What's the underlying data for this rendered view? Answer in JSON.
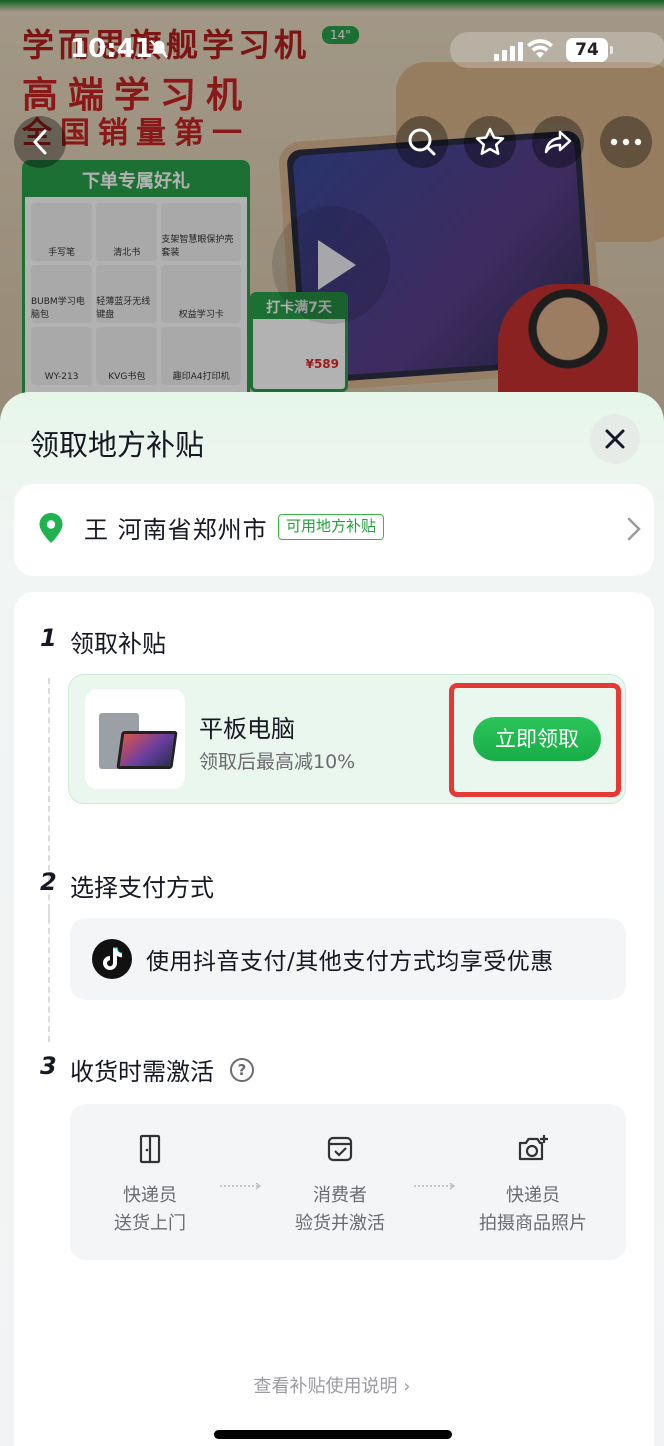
{
  "status_bar": {
    "time": "10:41",
    "battery": "74"
  },
  "background": {
    "headline_1": "学而思旗舰学习机",
    "badge": "14\"",
    "headline_2": "高端学习机",
    "headline_3": "全国销量第一",
    "gift_title": "下单专属好礼",
    "gift_items": [
      "手写笔",
      "清北书",
      "支架智慧眼保护壳套装",
      "BUBM学习电脑包",
      "轻薄蓝牙无线键盘",
      "权益学习卡",
      "WY-213",
      "KVG书包",
      "趣印A4打印机"
    ],
    "checkin_title": "打卡满7天",
    "checkin_price": "¥589"
  },
  "sheet": {
    "title": "领取地方补贴",
    "address": {
      "text": "王 河南省郑州市",
      "tag": "可用地方补贴"
    },
    "steps": [
      {
        "num": "1",
        "title": "领取补贴"
      },
      {
        "num": "2",
        "title": "选择支付方式"
      },
      {
        "num": "3",
        "title": "收货时需激活"
      }
    ],
    "product": {
      "name": "平板电脑",
      "desc": "领取后最高减10%",
      "button": "立即领取"
    },
    "payment": {
      "text": "使用抖音支付/其他支付方式均享受优惠"
    },
    "help": "?",
    "flow": [
      {
        "line1": "快递员",
        "line2": "送货上门",
        "icon": "door-icon"
      },
      {
        "line1": "消费者",
        "line2": "验货并激活",
        "icon": "box-check-icon"
      },
      {
        "line1": "快递员",
        "line2": "拍摄商品照片",
        "icon": "camera-add-icon"
      }
    ],
    "usage_link": "查看补贴使用说明 ›"
  },
  "colors": {
    "accent_green": "#1fb24f",
    "highlight_red": "#e53935"
  }
}
